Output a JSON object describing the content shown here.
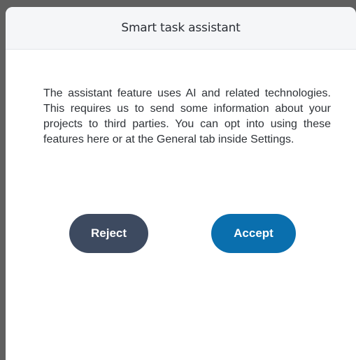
{
  "dialog": {
    "title": "Smart task assistant",
    "message": "The assistant feature uses AI and related technologies. This requires us to send some information about your projects to third parties. You can opt into using these features here or at the General tab inside Settings.",
    "reject_label": "Reject",
    "accept_label": "Accept"
  },
  "colors": {
    "reject_button": "#3d4a60",
    "accept_button": "#0a6fae",
    "header_background": "#f5f6f8"
  }
}
